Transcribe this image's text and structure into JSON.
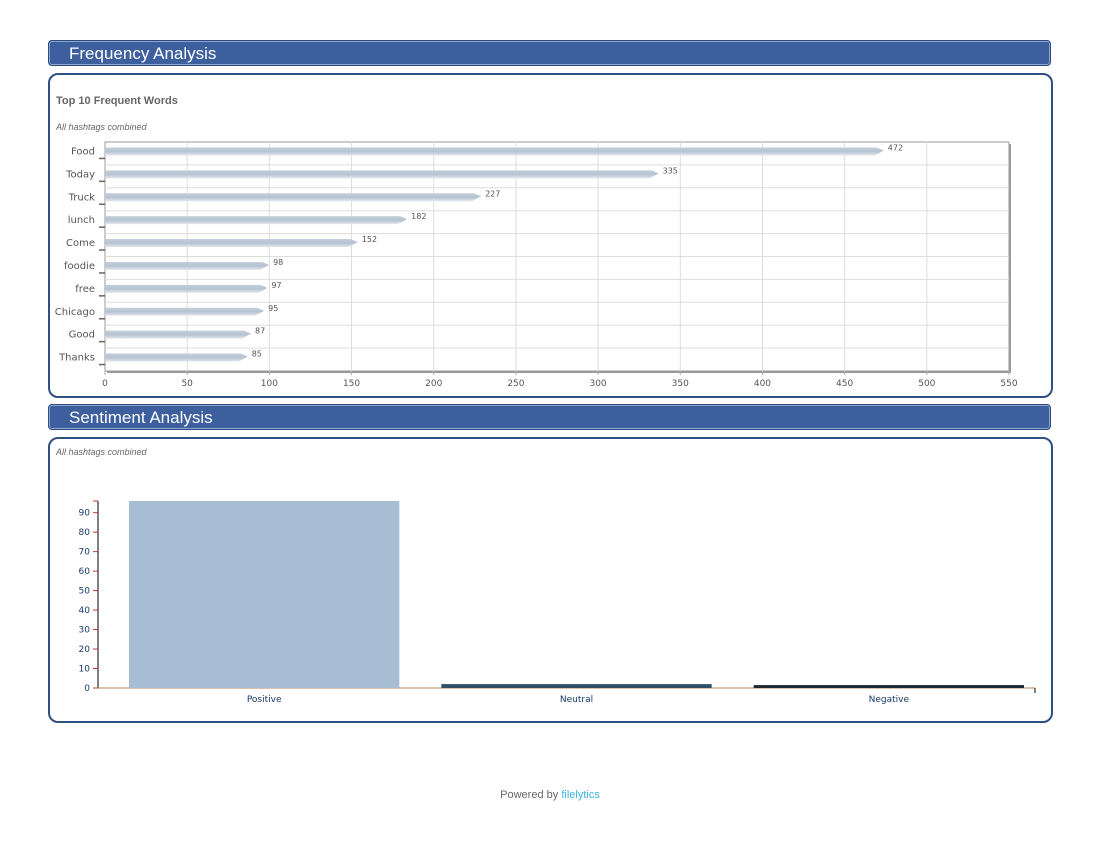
{
  "frequency": {
    "header": "Frequency Analysis",
    "chart_title": "Top 10 Frequent Words",
    "chart_subtitle": "All hashtags combined"
  },
  "sentiment": {
    "header": "Sentiment Analysis",
    "chart_subtitle": "All hashtags combined"
  },
  "footer": {
    "prefix": "Powered by",
    "brand": "filelytics"
  },
  "colors": {
    "header_bg": "#3d5f9e",
    "panel_border": "#2f4f84",
    "positive": "#a7bdd3",
    "neutral": "#2f4f68",
    "negative": "#1e2a33",
    "link": "#3bb4e0"
  },
  "chart_data": [
    {
      "type": "bar",
      "orientation": "horizontal",
      "title": "Top 10 Frequent Words",
      "subtitle": "All hashtags combined",
      "categories": [
        "Food",
        "Today",
        "Truck",
        "lunch",
        "Come",
        "foodie",
        "free",
        "Chicago",
        "Good",
        "Thanks"
      ],
      "values": [
        472,
        335,
        227,
        182,
        152,
        98,
        97,
        95,
        87,
        85
      ],
      "xlim": [
        0,
        550
      ],
      "xticks": [
        0,
        50,
        100,
        150,
        200,
        250,
        300,
        350,
        400,
        450,
        500,
        550
      ],
      "grid": true,
      "data_labels": true
    },
    {
      "type": "bar",
      "subtitle": "All hashtags combined",
      "categories": [
        "Positive",
        "Neutral",
        "Negative"
      ],
      "values": [
        96,
        2,
        1.5
      ],
      "ylim": [
        0,
        96
      ],
      "yticks": [
        0,
        10,
        20,
        30,
        40,
        50,
        60,
        70,
        80,
        90
      ],
      "grid": false
    }
  ]
}
